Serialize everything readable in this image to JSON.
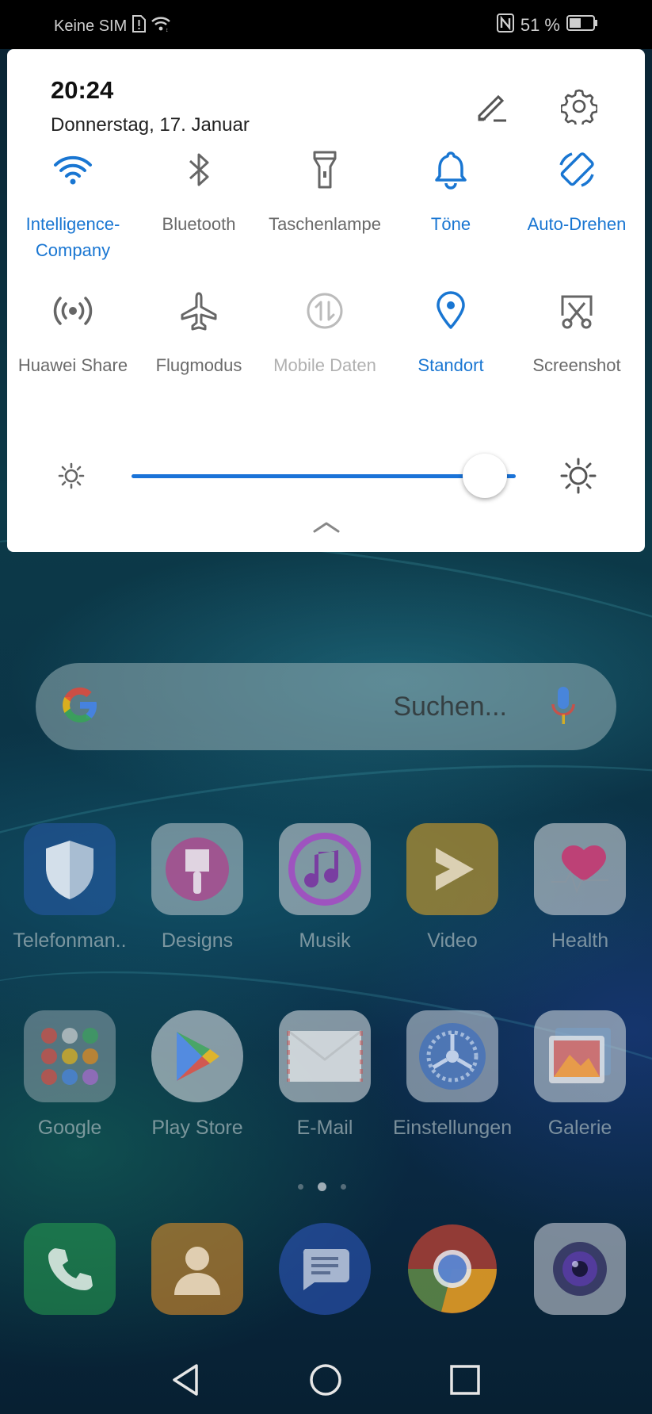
{
  "status_bar": {
    "carrier": "Keine SIM",
    "battery_percent": "51 %",
    "battery_level": 0.51
  },
  "panel": {
    "time": "20:24",
    "date": "Donnerstag, 17. Januar",
    "tiles": [
      {
        "label": "Intelligence-\nCompany",
        "icon": "wifi-icon",
        "state": "on"
      },
      {
        "label": "Bluetooth",
        "icon": "bluetooth-icon",
        "state": "off"
      },
      {
        "label": "Taschenlampe",
        "icon": "flashlight-icon",
        "state": "off"
      },
      {
        "label": "Töne",
        "icon": "bell-icon",
        "state": "on"
      },
      {
        "label": "Auto-Drehen",
        "icon": "auto-rotate-icon",
        "state": "on"
      },
      {
        "label": "Huawei Share",
        "icon": "huawei-share-icon",
        "state": "off"
      },
      {
        "label": "Flugmodus",
        "icon": "airplane-icon",
        "state": "off"
      },
      {
        "label": "Mobile Daten",
        "icon": "mobile-data-icon",
        "state": "disabled"
      },
      {
        "label": "Standort",
        "icon": "location-icon",
        "state": "on"
      },
      {
        "label": "Screenshot",
        "icon": "screenshot-icon",
        "state": "off"
      }
    ],
    "brightness_level": 0.92,
    "accent_color": "#1976d2"
  },
  "home": {
    "search_placeholder": "Suchen...",
    "apps_row1": [
      {
        "name": "Telefonman..",
        "icon": "shield-icon"
      },
      {
        "name": "Designs",
        "icon": "brush-icon"
      },
      {
        "name": "Musik",
        "icon": "music-note-icon"
      },
      {
        "name": "Video",
        "icon": "play-icon"
      },
      {
        "name": "Health",
        "icon": "heart-icon"
      }
    ],
    "apps_row2": [
      {
        "name": "Google",
        "icon": "google-folder-icon"
      },
      {
        "name": "Play Store",
        "icon": "play-store-icon"
      },
      {
        "name": "E-Mail",
        "icon": "envelope-icon"
      },
      {
        "name": "Einstellungen",
        "icon": "settings-wheel-icon"
      },
      {
        "name": "Galerie",
        "icon": "gallery-icon"
      }
    ],
    "dock": [
      {
        "icon": "phone-icon"
      },
      {
        "icon": "contacts-icon"
      },
      {
        "icon": "messages-icon"
      },
      {
        "icon": "chrome-icon"
      },
      {
        "icon": "camera-icon"
      }
    ],
    "page_count": 3,
    "active_page": 2
  }
}
